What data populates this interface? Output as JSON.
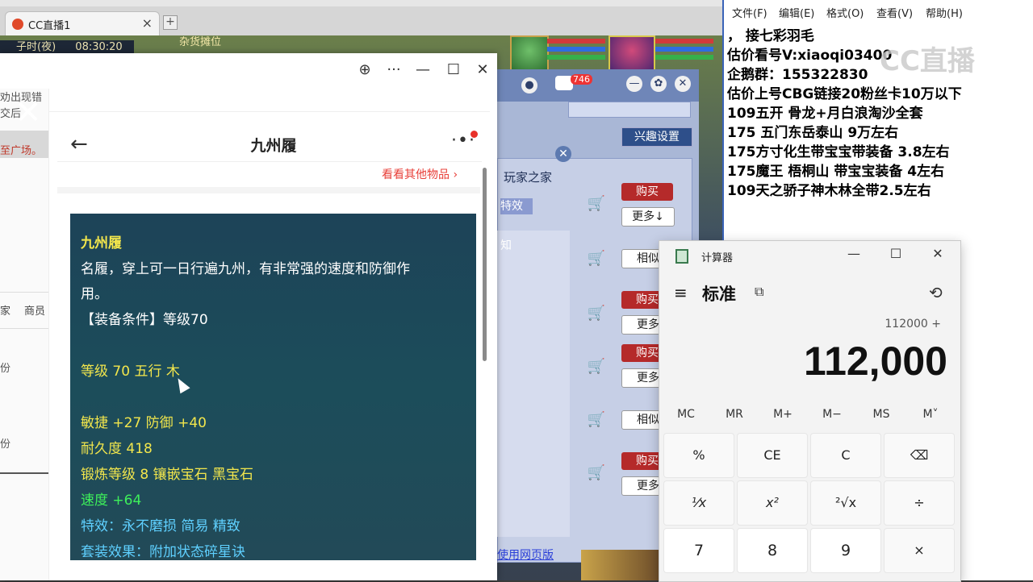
{
  "browser": {
    "tab_title": "CC直播1",
    "tab_close": "×",
    "new_tab": "+"
  },
  "game": {
    "clock_left": "子时(夜)",
    "clock_time": "08:30:20",
    "banner": "杂货摊位",
    "interest_settings": "兴趣设置",
    "player_home": "玩家之家",
    "special_effect": "特效",
    "know": "知",
    "buy_label": "购买",
    "more_label": "更多",
    "more_down_label": "更多↓",
    "similar_label": "相似",
    "web_version": "使用网页版",
    "msg_count": "746"
  },
  "left_strip": {
    "text1": "劝出现错",
    "text2": "交后",
    "text3": "至广场。",
    "menu1": "家",
    "menu2": "商员",
    "text4": "份",
    "text5": "份"
  },
  "popup": {
    "globe": "⊕",
    "dots": "···",
    "minimize": "—",
    "maximize": "☐",
    "close": "✕",
    "back_arrow": "←",
    "title": "九州履",
    "see_other": "看看其他物品 ›",
    "big_x": "✕"
  },
  "item_desc": {
    "name": "九州履",
    "desc1": "名履，穿上可一日行遍九州，有非常强的速度和防御作",
    "desc2": "用。",
    "requirement": "【装备条件】等级70",
    "level_element": "等级 70 五行 木",
    "agility_defense": "敏捷 +27 防御 +40",
    "durability": "耐久度 418",
    "forge": "锻炼等级 8 镶嵌宝石 黑宝石",
    "speed": "速度 +64",
    "special": "特效：永不磨损 简易 精致",
    "set_effect": "套装效果：附加状态碎星诀"
  },
  "notepad": {
    "menu": [
      "文件(F)",
      "编辑(E)",
      "格式(O)",
      "查看(V)",
      "帮助(H)"
    ],
    "lines": [
      "，      接七彩羽毛",
      "估价看号V:xiaoqi03400",
      "企鹅群：155322830",
      "估价上号CBG链接20粉丝卡10万以下",
      "109五开 骨龙+月白浪淘沙全套",
      "175 五门东岳泰山  9万左右",
      "175方寸化生带宝宝带装备  3.8左右",
      "175魔王 梧桐山  带宝宝装备 4左右",
      "109天之骄子神木林全带2.5左右"
    ],
    "watermark": "CC直播"
  },
  "calculator": {
    "app_title": "计算器",
    "mode": "标准",
    "keep_on_top": "⧉",
    "history": "⟲",
    "hamburger": "≡",
    "minimize": "—",
    "maximize": "☐",
    "close": "✕",
    "expression": "112000 +",
    "display": "112,000",
    "memory": [
      "MC",
      "MR",
      "M+",
      "M−",
      "MS",
      "M˅"
    ],
    "row1": [
      "%",
      "CE",
      "C",
      "⌫"
    ],
    "row2": [
      "¹⁄x",
      "x²",
      "²√x",
      "÷"
    ],
    "row3": [
      "7",
      "8",
      "9",
      "×"
    ]
  },
  "colors": {
    "desc_bg": "#1f4a5c",
    "desc_yellow": "#f2e64c",
    "desc_green": "#3ef05a",
    "desc_cyan": "#5fd0ff",
    "see_other_red": "#e8403a"
  }
}
